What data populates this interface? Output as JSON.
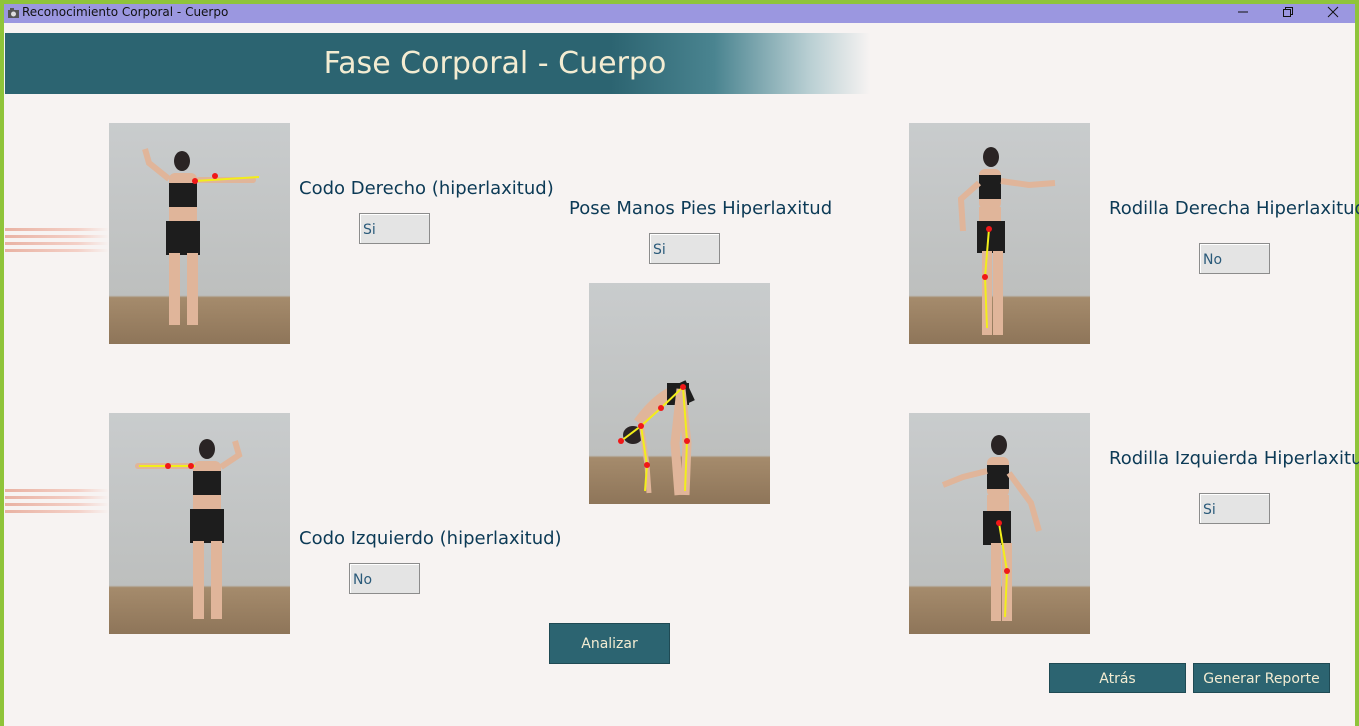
{
  "window": {
    "title": "Reconocimiento Corporal - Cuerpo"
  },
  "header": {
    "title": "Fase Corporal - Cuerpo"
  },
  "panels": {
    "codo_derecho": {
      "label": "Codo Derecho (hiperlaxitud)",
      "value": "Si"
    },
    "codo_izquierdo": {
      "label": "Codo Izquierdo (hiperlaxitud)",
      "value": "No"
    },
    "pose_manos_pies": {
      "label": "Pose Manos Pies Hiperlaxitud",
      "value": "Si"
    },
    "rodilla_derecha": {
      "label": "Rodilla Derecha Hiperlaxitud",
      "value": "No"
    },
    "rodilla_izquierda": {
      "label": "Rodilla Izquierda Hiperlaxitud",
      "value": "Si"
    }
  },
  "buttons": {
    "analizar": "Analizar",
    "atras": "Atrás",
    "generar_reporte": "Generar Reporte"
  },
  "icons": {
    "app": "app-icon",
    "minimize": "minimize-icon",
    "maximize": "restore-icon",
    "close": "close-icon"
  },
  "colors": {
    "accent": "#2c6471",
    "frame": "#8fc43a",
    "titlebar": "#9b97e0",
    "label": "#0c3a56"
  }
}
